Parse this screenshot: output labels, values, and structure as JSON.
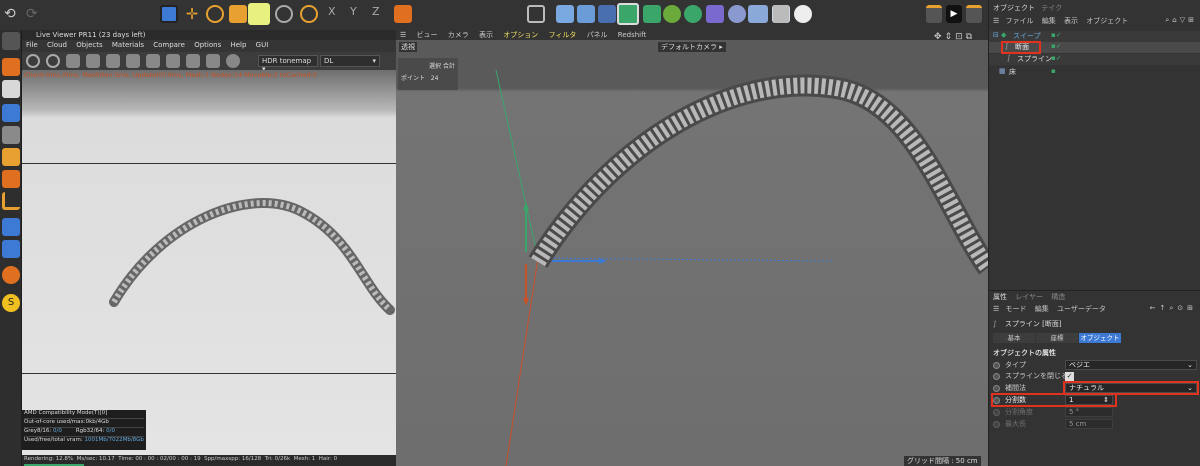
{
  "colors": {
    "accent_blue": "#3d7ad6",
    "red_box": "#e0321e",
    "grid_bg": "#6a6a6a",
    "viewer_bg": "#dcdcdc"
  },
  "live_viewer": {
    "title": "Live Viewer PR11 (23 days left)",
    "menu": [
      "File",
      "Cloud",
      "Objects",
      "Materials",
      "Compare",
      "Options",
      "Help",
      "GUI"
    ],
    "tonemap": "HDR tonemap",
    "dl": "DL",
    "status_line": "Check:0ms./0ms, MeshGen:5ms, Update(0):0ms, Mesh:1 Nodes:14 Movable:2 txCached:0",
    "info": [
      {
        "label": "AMD Compatibility Mode(T)[0]"
      },
      {
        "label": "Out-of-core used/max:0kb/4Gb"
      },
      {
        "label": "Grey8/16:",
        "a": "0/0",
        "b_label": "Rgb32/64:",
        "b": "0/0"
      },
      {
        "label": "Used/free/total vram:",
        "a": "1001Mb/7022Mb/8Gb"
      }
    ],
    "footer": {
      "rendering": "Rendering: 12.8%",
      "ms": "Ms/sec: 10.17",
      "time": "Time: 00 : 00 : 02/00 : 00 : 19",
      "spp": "Spp/maxspp: 16/128",
      "tri": "Tri: 0/26k",
      "mesh": "Mesh: 1",
      "hair": "Hair: 0"
    }
  },
  "viewport": {
    "menu": [
      "ビュー",
      "カメラ",
      "表示",
      "オプション",
      "フィルタ",
      "パネル",
      "Redshift"
    ],
    "label": "透視",
    "camera": "デフォルトカメラ",
    "stats": {
      "h1": "選択",
      "h2": "合計",
      "row_label": "ポイント",
      "row_value": "24"
    },
    "grid": "グリッド間隔 : 50 cm"
  },
  "object_manager": {
    "tabs": [
      "オブジェクト",
      "テイク"
    ],
    "menu": [
      "ファイル",
      "編集",
      "表示",
      "オブジェクト"
    ],
    "items": [
      {
        "name": "スイープ"
      },
      {
        "name": "断面"
      },
      {
        "name": "スプライン"
      },
      {
        "name": "床"
      }
    ]
  },
  "attributes": {
    "tabs": [
      "属性",
      "レイヤー",
      "構造"
    ],
    "menu": [
      "モード",
      "編集",
      "ユーザーデータ"
    ],
    "object_title": "スプライン [断面]",
    "subtabs": [
      "基本",
      "座標",
      "オブジェクト"
    ],
    "section": "オブジェクトの属性",
    "fields": [
      {
        "label": "タイプ",
        "value": "ベジエ"
      },
      {
        "label": "スプラインを閉じる",
        "value": "✓"
      },
      {
        "label": "補間法",
        "value": "ナチュラル"
      },
      {
        "label": "分割数",
        "value": "1"
      },
      {
        "label": "分割角度",
        "value": "5 °"
      },
      {
        "label": "最大長",
        "value": "5 cm"
      }
    ]
  }
}
